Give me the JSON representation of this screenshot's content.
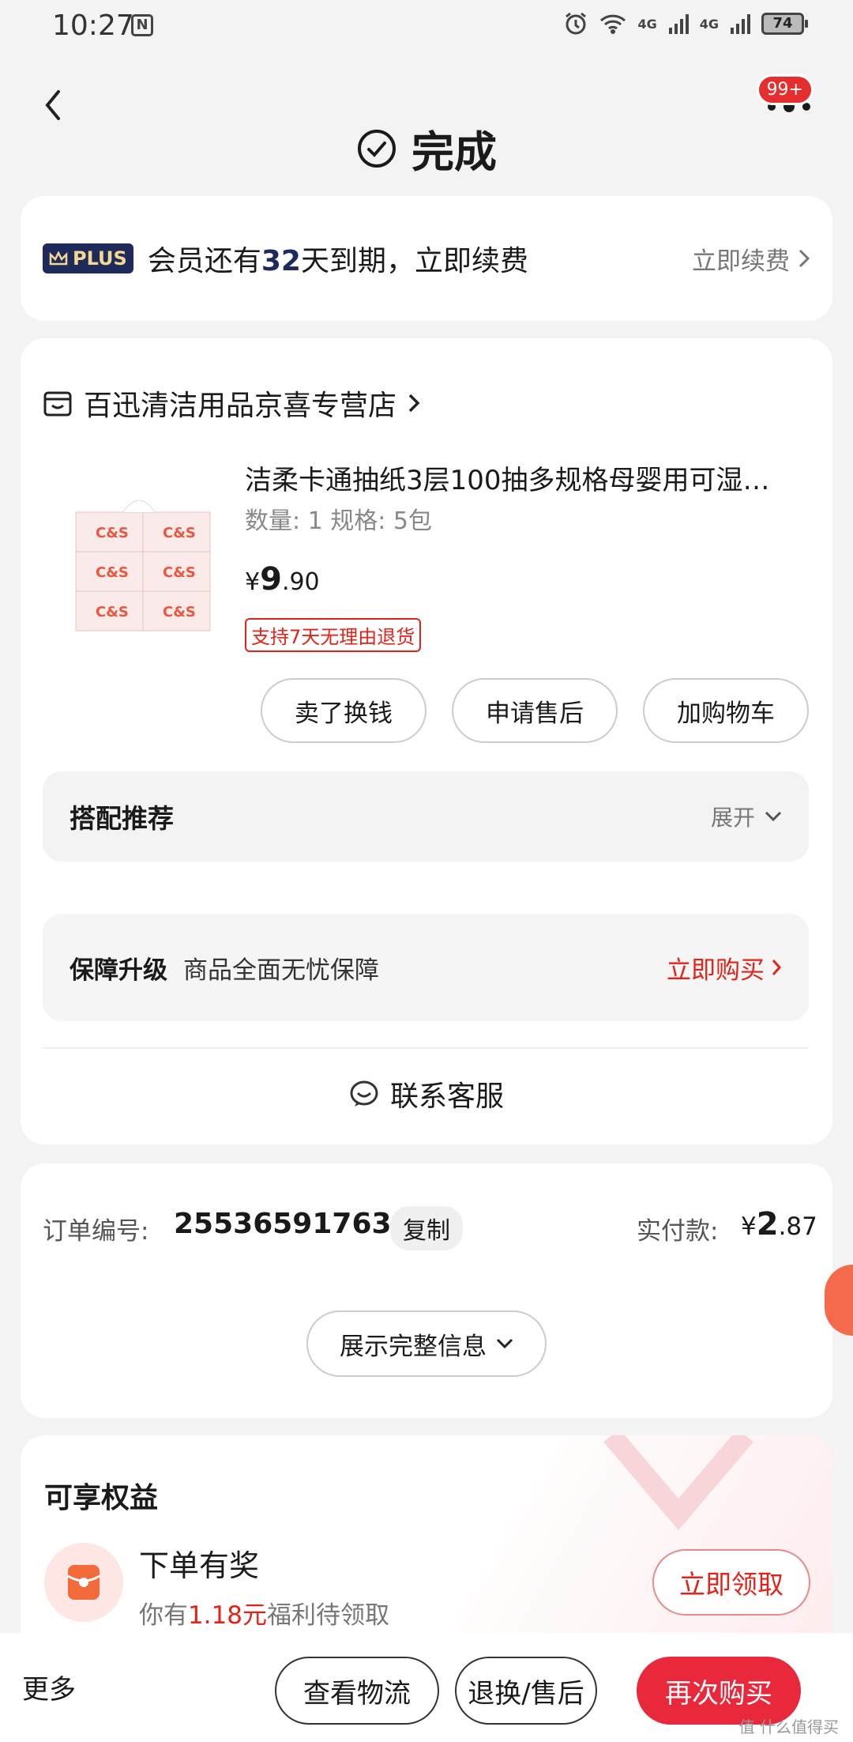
{
  "status": {
    "time": "10:27",
    "signal1": "4G",
    "signal2": "4G",
    "battery": "74"
  },
  "header": {
    "title": "完成",
    "badge": "99+"
  },
  "plus": {
    "logo": "PLUS",
    "text_pre": "会员还有",
    "days": "32",
    "text_post": "天到期，立即续费",
    "renew": "立即续费"
  },
  "store": {
    "name": "百迅清洁用品京喜专营店"
  },
  "product": {
    "title": "洁柔卡通抽纸3层100抽多规格母婴用可湿…",
    "spec": "数量: 1   规格: 5包",
    "price_symbol": "¥",
    "price_int": "9",
    "price_dec": ".90",
    "return_tag": "支持7天无理由退货",
    "image_label": "C&S"
  },
  "actions": {
    "sell": "卖了换钱",
    "after_sale": "申请售后",
    "add_cart": "加购物车"
  },
  "recommend": {
    "title": "搭配推荐",
    "expand": "展开"
  },
  "guarantee": {
    "title": "保障升级",
    "desc": "商品全面无忧保障",
    "buy": "立即购买"
  },
  "service": {
    "label": "联系客服"
  },
  "order": {
    "no_label": "订单编号:",
    "no": "255365917631",
    "copy": "复制",
    "paid_label": "实付款:",
    "paid_symbol": "¥",
    "paid_int": "2",
    "paid_dec": ".87",
    "show_more": "展示完整信息"
  },
  "benefits": {
    "title": "可享权益",
    "name": "下单有奖",
    "desc_pre": "你有",
    "desc_amount": "1.18元",
    "desc_post": "福利待领取",
    "claim": "立即领取"
  },
  "bottom": {
    "more": "更多",
    "logistics": "查看物流",
    "return": "退换/售后",
    "rebuy": "再次购买"
  },
  "watermark": "值 什么值得买",
  "colors": {
    "accent": "#e2231a",
    "primary_button": "#e9283b",
    "plus_navy": "#1e2a5a"
  }
}
